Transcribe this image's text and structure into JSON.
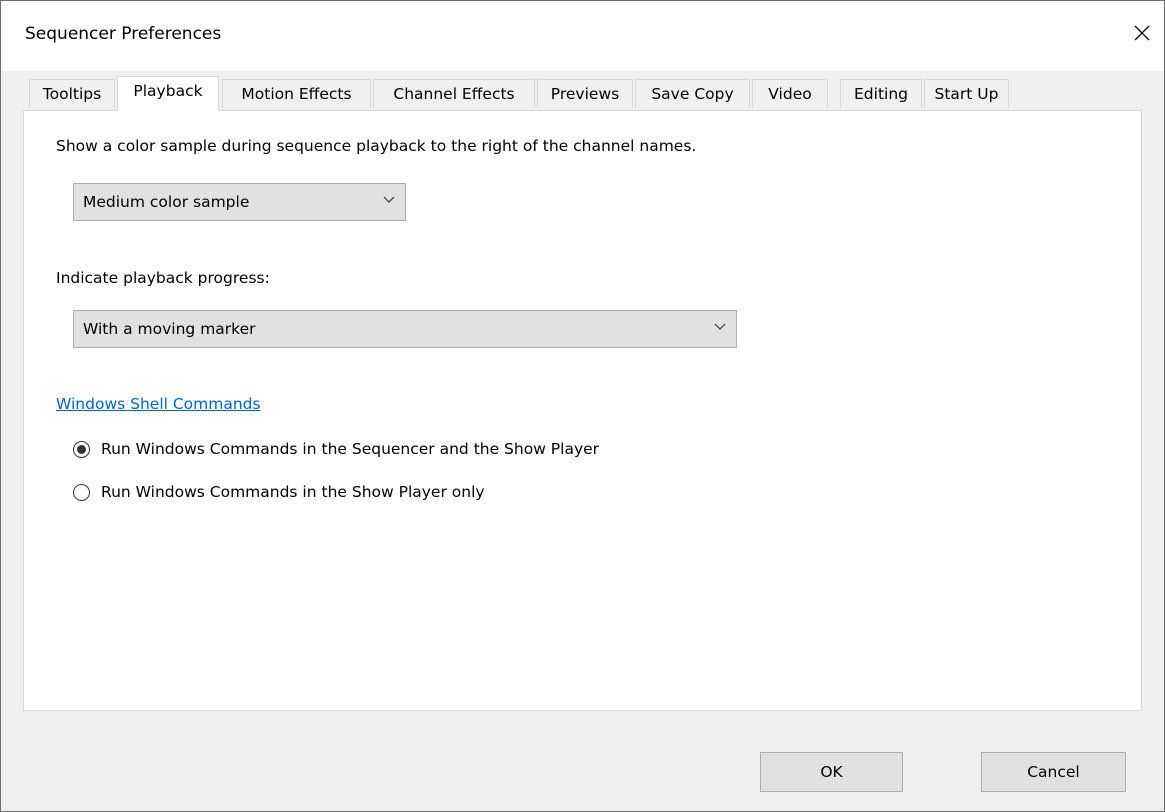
{
  "window": {
    "title": "Sequencer Preferences",
    "close_icon": "close-icon"
  },
  "tabs": [
    {
      "label": "Tooltips"
    },
    {
      "label": "Playback",
      "active": true
    },
    {
      "label": "Motion Effects"
    },
    {
      "label": "Channel Effects"
    },
    {
      "label": "Previews"
    },
    {
      "label": "Save Copy"
    },
    {
      "label": "Video"
    },
    {
      "label": "Editing"
    },
    {
      "label": "Start Up"
    }
  ],
  "playback": {
    "color_sample_label": "Show a color sample during sequence playback to the right of the channel names.",
    "color_sample_value": "Medium color sample",
    "progress_label": "Indicate playback progress:",
    "progress_value": "With a moving marker",
    "shell_link": "Windows Shell Commands",
    "radio_options": [
      {
        "label": "Run Windows Commands in the Sequencer and the Show Player",
        "checked": true
      },
      {
        "label": "Run Windows Commands in the Show Player only",
        "checked": false
      }
    ]
  },
  "buttons": {
    "ok": "OK",
    "cancel": "Cancel"
  }
}
